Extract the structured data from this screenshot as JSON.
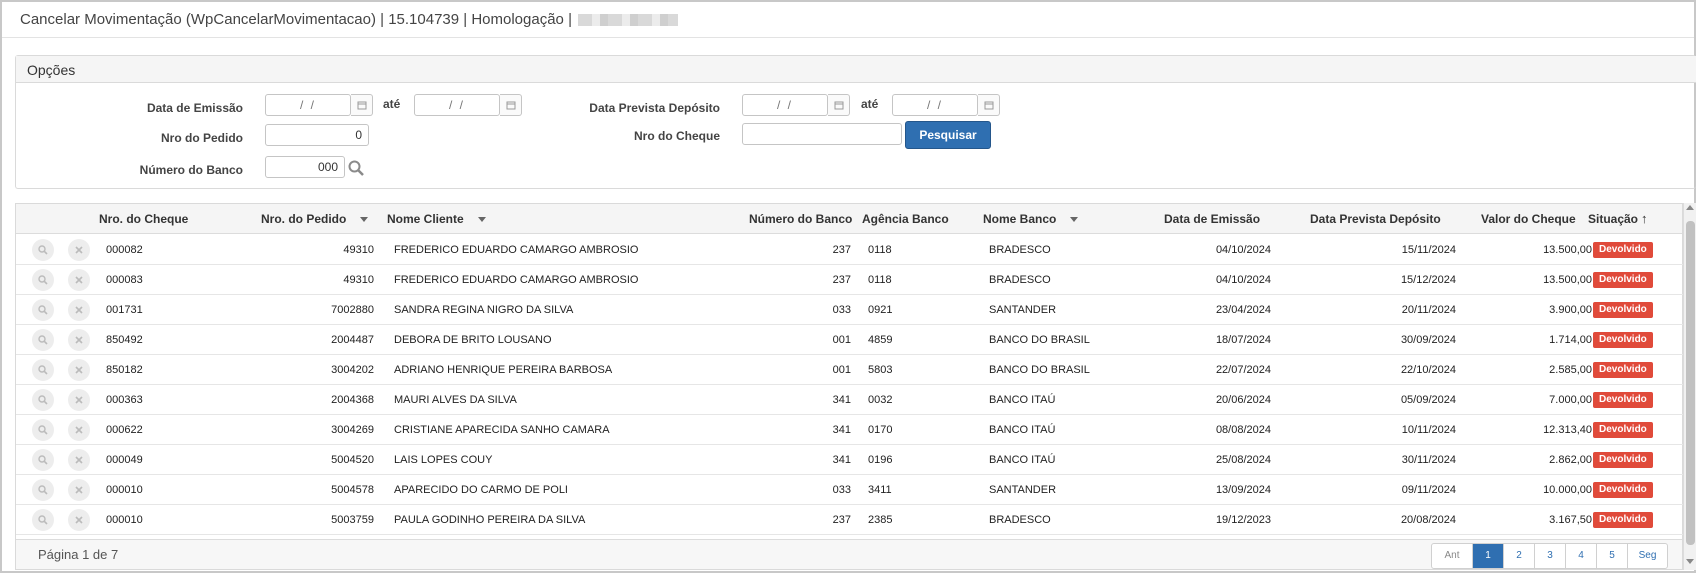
{
  "window": {
    "title": "Cancelar Movimentação (WpCancelarMovimentacao) | 15.104739 | Homologação |"
  },
  "options": {
    "header": "Opções",
    "data_emissao_label": "Data de Emissão",
    "ate_label": "até",
    "data_prevista_label": "Data Prevista Depósito",
    "nro_pedido_label": "Nro do Pedido",
    "nro_pedido_value": "0",
    "nro_cheque_label": "Nro do Cheque",
    "nro_cheque_value": "",
    "numero_banco_label": "Número do Banco",
    "numero_banco_value": "000",
    "date_placeholder": "/ /",
    "search_button": "Pesquisar"
  },
  "table": {
    "columns": {
      "nro_cheque": "Nro. do Cheque",
      "nro_pedido": "Nro. do Pedido",
      "nome_cliente": "Nome Cliente",
      "numero_banco": "Número do Banco",
      "agencia": "Agência Banco",
      "nome_banco": "Nome Banco",
      "data_emissao": "Data de Emissão",
      "data_prevista": "Data Prevista Depósito",
      "valor": "Valor do Cheque",
      "situacao": "Situação"
    },
    "rows": [
      {
        "cheque": "000082",
        "pedido": "49310",
        "cliente": "FREDERICO EDUARDO CAMARGO AMBROSIO",
        "banco": "237",
        "agencia": "0118",
        "nome_banco": "BRADESCO",
        "emissao": "04/10/2024",
        "prevista": "15/11/2024",
        "valor": "13.500,00",
        "situacao": "Devolvido"
      },
      {
        "cheque": "000083",
        "pedido": "49310",
        "cliente": "FREDERICO EDUARDO CAMARGO AMBROSIO",
        "banco": "237",
        "agencia": "0118",
        "nome_banco": "BRADESCO",
        "emissao": "04/10/2024",
        "prevista": "15/12/2024",
        "valor": "13.500,00",
        "situacao": "Devolvido"
      },
      {
        "cheque": "001731",
        "pedido": "7002880",
        "cliente": "SANDRA REGINA NIGRO DA SILVA",
        "banco": "033",
        "agencia": "0921",
        "nome_banco": "SANTANDER",
        "emissao": "23/04/2024",
        "prevista": "20/11/2024",
        "valor": "3.900,00",
        "situacao": "Devolvido"
      },
      {
        "cheque": "850492",
        "pedido": "2004487",
        "cliente": "DEBORA DE BRITO LOUSANO",
        "banco": "001",
        "agencia": "4859",
        "nome_banco": "BANCO DO BRASIL",
        "emissao": "18/07/2024",
        "prevista": "30/09/2024",
        "valor": "1.714,00",
        "situacao": "Devolvido"
      },
      {
        "cheque": "850182",
        "pedido": "3004202",
        "cliente": "ADRIANO HENRIQUE PEREIRA BARBOSA",
        "banco": "001",
        "agencia": "5803",
        "nome_banco": "BANCO DO BRASIL",
        "emissao": "22/07/2024",
        "prevista": "22/10/2024",
        "valor": "2.585,00",
        "situacao": "Devolvido"
      },
      {
        "cheque": "000363",
        "pedido": "2004368",
        "cliente": "MAURI ALVES DA SILVA",
        "banco": "341",
        "agencia": "0032",
        "nome_banco": "BANCO ITAÚ",
        "emissao": "20/06/2024",
        "prevista": "05/09/2024",
        "valor": "7.000,00",
        "situacao": "Devolvido"
      },
      {
        "cheque": "000622",
        "pedido": "3004269",
        "cliente": "CRISTIANE APARECIDA SANHO CAMARA",
        "banco": "341",
        "agencia": "0170",
        "nome_banco": "BANCO ITAÚ",
        "emissao": "08/08/2024",
        "prevista": "10/11/2024",
        "valor": "12.313,40",
        "situacao": "Devolvido"
      },
      {
        "cheque": "000049",
        "pedido": "5004520",
        "cliente": "LAIS LOPES COUY",
        "banco": "341",
        "agencia": "0196",
        "nome_banco": "BANCO ITAÚ",
        "emissao": "25/08/2024",
        "prevista": "30/11/2024",
        "valor": "2.862,00",
        "situacao": "Devolvido"
      },
      {
        "cheque": "000010",
        "pedido": "5004578",
        "cliente": "APARECIDO DO CARMO DE POLI",
        "banco": "033",
        "agencia": "3411",
        "nome_banco": "SANTANDER",
        "emissao": "13/09/2024",
        "prevista": "09/11/2024",
        "valor": "10.000,00",
        "situacao": "Devolvido"
      },
      {
        "cheque": "000010",
        "pedido": "5003759",
        "cliente": "PAULA GODINHO PEREIRA DA SILVA",
        "banco": "237",
        "agencia": "2385",
        "nome_banco": "BRADESCO",
        "emissao": "19/12/2023",
        "prevista": "20/08/2024",
        "valor": "3.167,50",
        "situacao": "Devolvido"
      }
    ]
  },
  "pagination": {
    "info": "Página 1 de 7",
    "prev": "Ant",
    "pages": [
      "1",
      "2",
      "3",
      "4",
      "5"
    ],
    "current": "1",
    "next": "Seg"
  },
  "colors": {
    "primary": "#2f6fb1",
    "badge": "#e04a3a"
  }
}
